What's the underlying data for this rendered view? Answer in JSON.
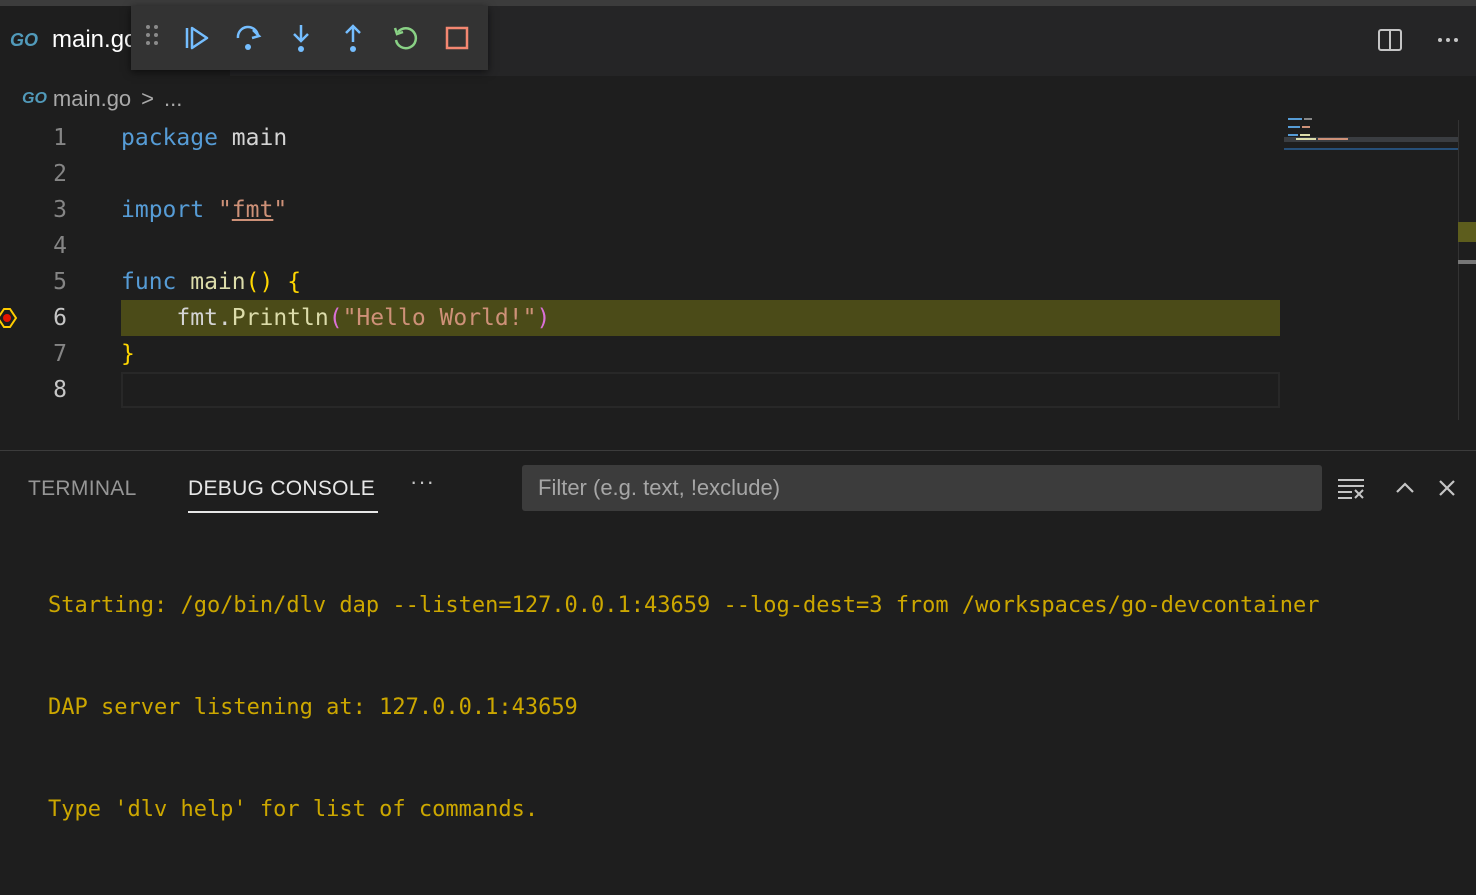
{
  "tab": {
    "logo": "GO",
    "label": "main.go"
  },
  "breadcrumb": {
    "logo": "GO",
    "file": "main.go",
    "sep": ">",
    "more": "..."
  },
  "debug_toolbar": {
    "buttons": [
      {
        "name": "continue",
        "icon": "continue-icon"
      },
      {
        "name": "step-over",
        "icon": "step-over-icon"
      },
      {
        "name": "step-into",
        "icon": "step-into-icon"
      },
      {
        "name": "step-out",
        "icon": "step-out-icon"
      },
      {
        "name": "restart",
        "icon": "restart-icon"
      },
      {
        "name": "stop",
        "icon": "stop-icon"
      }
    ],
    "colors": {
      "blue": "#75beff",
      "green": "#89d185",
      "red": "#f48771"
    }
  },
  "editor": {
    "line_numbers": [
      "1",
      "2",
      "3",
      "4",
      "5",
      "6",
      "7",
      "8"
    ],
    "lines": {
      "l1_kw": "package",
      "l1_rest": " main",
      "l3_kw": "import",
      "l3_q1": " \"",
      "l3_str": "fmt",
      "l3_q2": "\"",
      "l5_kw": "func",
      "l5_fn": " main",
      "l5_paren": "()",
      "l5_brace": " {",
      "l6_indent": "    ",
      "l6_obj": "fmt.",
      "l6_fn": "Println",
      "l6_p1": "(",
      "l6_str": "\"Hello World!\"",
      "l6_p2": ")",
      "l7_brace": "}"
    },
    "current_line": 6,
    "highlight_color": "#4b4b18"
  },
  "panel": {
    "tabs": [
      {
        "label": "TERMINAL"
      },
      {
        "label": "DEBUG CONSOLE"
      }
    ],
    "more": "···",
    "filter_placeholder": "Filter (e.g. text, !exclude)",
    "console_lines": [
      "Starting: /go/bin/dlv dap --listen=127.0.0.1:43659 --log-dest=3 from /workspaces/go-devcontainer",
      "DAP server listening at: 127.0.0.1:43659",
      "Type 'dlv help' for list of commands."
    ]
  }
}
